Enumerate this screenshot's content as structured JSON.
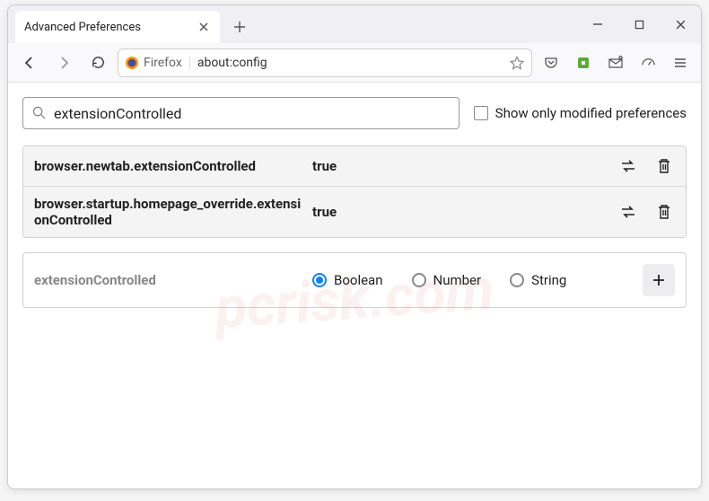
{
  "tab": {
    "title": "Advanced Preferences"
  },
  "address": {
    "scheme_label": "Firefox",
    "url": "about:config"
  },
  "search": {
    "value": "extensionControlled",
    "modified_label": "Show only modified preferences"
  },
  "prefs": [
    {
      "name": "browser.newtab.extensionControlled",
      "value": "true"
    },
    {
      "name": "browser.startup.homepage_override.extensionControlled",
      "value": "true"
    }
  ],
  "new_pref": {
    "name": "extensionControlled",
    "types": [
      "Boolean",
      "Number",
      "String"
    ],
    "selected": 0
  },
  "watermark": "pcrisk.com"
}
